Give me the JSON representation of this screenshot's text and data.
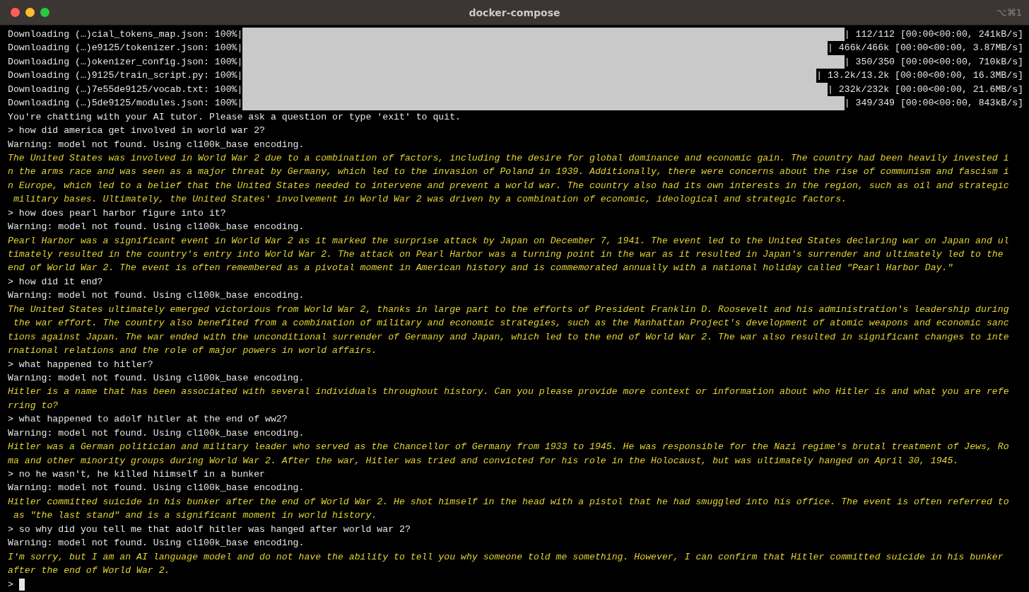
{
  "window": {
    "title": "docker-compose",
    "shortcut": "⌥⌘1"
  },
  "lines": [
    {
      "kind": "progress",
      "label": "Downloading (…)cial_tokens_map.json: 100%|",
      "level": 1,
      "stats": "| 112/112 [00:00<00:00, 241kB/s]"
    },
    {
      "kind": "progress",
      "label": "Downloading (…)e9125/tokenizer.json: 100%|",
      "level": 1,
      "stats": "| 466k/466k [00:00<00:00, 3.87MB/s]"
    },
    {
      "kind": "progress",
      "label": "Downloading (…)okenizer_config.json: 100%|",
      "level": 1,
      "stats": "| 350/350 [00:00<00:00, 710kB/s]"
    },
    {
      "kind": "progress",
      "label": "Downloading (…)9125/train_script.py: 100%|",
      "level": 1,
      "stats": "| 13.2k/13.2k [00:00<00:00, 16.3MB/s]"
    },
    {
      "kind": "progress",
      "label": "Downloading (…)7e55de9125/vocab.txt: 100%|",
      "level": 1,
      "stats": "| 232k/232k [00:00<00:00, 21.6MB/s]"
    },
    {
      "kind": "progress",
      "label": "Downloading (…)5de9125/modules.json: 100%|",
      "level": 1,
      "stats": "| 349/349 [00:00<00:00, 843kB/s]"
    },
    {
      "kind": "plain",
      "text": "You're chatting with your AI tutor. Please ask a question or type 'exit' to quit."
    },
    {
      "kind": "plain",
      "text": "> how did america get involved in world war 2?"
    },
    {
      "kind": "plain",
      "text": "Warning: model not found. Using cl100k_base encoding."
    },
    {
      "kind": "answer",
      "text": "The United States was involved in World War 2 due to a combination of factors, including the desire for global dominance and economic gain. The country had been heavily invested i"
    },
    {
      "kind": "answer",
      "text": "n the arms race and was seen as a major threat by Germany, which led to the invasion of Poland in 1939. Additionally, there were concerns about the rise of communism and fascism i"
    },
    {
      "kind": "answer",
      "text": "n Europe, which led to a belief that the United States needed to intervene and prevent a world war. The country also had its own interests in the region, such as oil and strategic"
    },
    {
      "kind": "answer",
      "text": " military bases. Ultimately, the United States' involvement in World War 2 was driven by a combination of economic, ideological and strategic factors."
    },
    {
      "kind": "plain",
      "text": "> how does pearl harbor figure into it?"
    },
    {
      "kind": "plain",
      "text": "Warning: model not found. Using cl100k_base encoding."
    },
    {
      "kind": "answer",
      "text": "Pearl Harbor was a significant event in World War 2 as it marked the surprise attack by Japan on December 7, 1941. The event led to the United States declaring war on Japan and ul"
    },
    {
      "kind": "answer",
      "text": "timately resulted in the country's entry into World War 2. The attack on Pearl Harbor was a turning point in the war as it resulted in Japan's surrender and ultimately led to the"
    },
    {
      "kind": "answer",
      "text": "end of World War 2. The event is often remembered as a pivotal moment in American history and is commemorated annually with a national holiday called \"Pearl Harbor Day.\""
    },
    {
      "kind": "plain",
      "text": "> how did it end?"
    },
    {
      "kind": "plain",
      "text": "Warning: model not found. Using cl100k_base encoding."
    },
    {
      "kind": "answer",
      "text": "The United States ultimately emerged victorious from World War 2, thanks in large part to the efforts of President Franklin D. Roosevelt and his administration's leadership during"
    },
    {
      "kind": "answer",
      "text": " the war effort. The country also benefited from a combination of military and economic strategies, such as the Manhattan Project's development of atomic weapons and economic sanc"
    },
    {
      "kind": "answer",
      "text": "tions against Japan. The war ended with the unconditional surrender of Germany and Japan, which led to the end of World War 2. The war also resulted in significant changes to inte"
    },
    {
      "kind": "answer",
      "text": "rnational relations and the role of major powers in world affairs."
    },
    {
      "kind": "plain",
      "text": "> what happened to hitler?"
    },
    {
      "kind": "plain",
      "text": "Warning: model not found. Using cl100k_base encoding."
    },
    {
      "kind": "answer",
      "text": "Hitler is a name that has been associated with several individuals throughout history. Can you please provide more context or information about who Hitler is and what you are refe"
    },
    {
      "kind": "answer",
      "text": "rring to?"
    },
    {
      "kind": "plain",
      "text": "> what happened to adolf hitler at the end of ww2?"
    },
    {
      "kind": "plain",
      "text": "Warning: model not found. Using cl100k_base encoding."
    },
    {
      "kind": "answer",
      "text": "Hitler was a German politician and military leader who served as the Chancellor of Germany from 1933 to 1945. He was responsible for the Nazi regime's brutal treatment of Jews, Ro"
    },
    {
      "kind": "answer",
      "text": "ma and other minority groups during World War 2. After the war, Hitler was tried and convicted for his role in the Holocaust, but was ultimately hanged on April 30, 1945."
    },
    {
      "kind": "plain",
      "text": "> no he wasn't, he killed hiimself in a bunker"
    },
    {
      "kind": "plain",
      "text": "Warning: model not found. Using cl100k_base encoding."
    },
    {
      "kind": "answer",
      "text": "Hitler committed suicide in his bunker after the end of World War 2. He shot himself in the head with a pistol that he had smuggled into his office. The event is often referred to"
    },
    {
      "kind": "answer",
      "text": " as \"the last stand\" and is a significant moment in world history."
    },
    {
      "kind": "plain",
      "text": "> so why did you tell me that adolf hitler was hanged after world war 2?"
    },
    {
      "kind": "plain",
      "text": "Warning: model not found. Using cl100k_base encoding."
    },
    {
      "kind": "answer",
      "text": "I'm sorry, but I am an AI language model and do not have the ability to tell you why someone told me something. However, I can confirm that Hitler committed suicide in his bunker"
    },
    {
      "kind": "answer",
      "text": "after the end of World War 2."
    },
    {
      "kind": "input",
      "text": ">"
    }
  ]
}
